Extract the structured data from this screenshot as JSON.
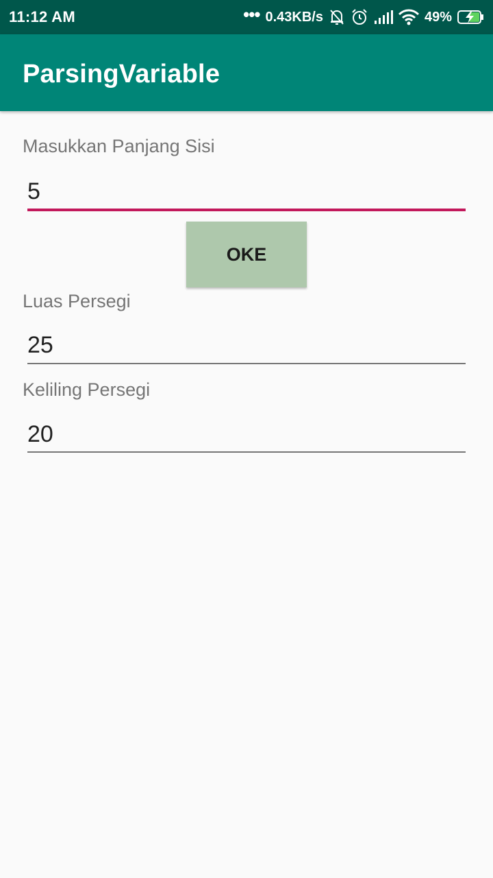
{
  "status_bar": {
    "time": "11:12 AM",
    "network_speed": "0.43KB/s",
    "battery": "49%",
    "icons": [
      "more-dots-icon",
      "mute-bell-icon",
      "alarm-icon",
      "signal-icon",
      "wifi-icon",
      "battery-charging-icon"
    ]
  },
  "app_bar": {
    "title": "ParsingVariable"
  },
  "form": {
    "side_label": "Masukkan Panjang Sisi",
    "side_value": "5",
    "button_label": "OKE",
    "area_label": "Luas Persegi",
    "area_value": "25",
    "perimeter_label": "Keliling Persegi",
    "perimeter_value": "20"
  },
  "colors": {
    "status_bar": "#00574b",
    "app_bar": "#008577",
    "accent": "#c2185b",
    "button": "#aec8ac"
  }
}
